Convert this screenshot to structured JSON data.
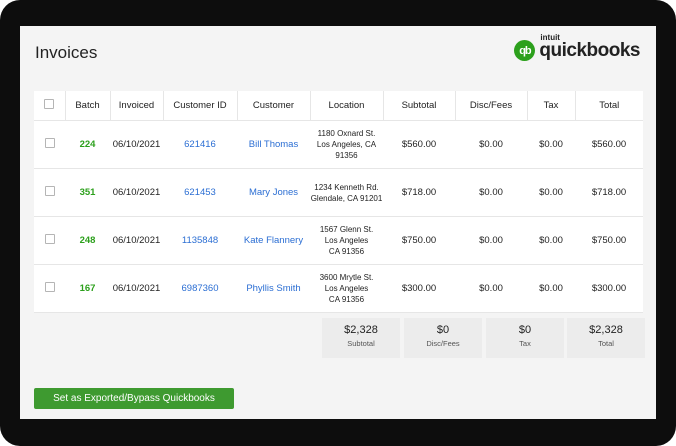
{
  "page": {
    "title": "Invoices"
  },
  "logo": {
    "brand_small": "intuit",
    "brand": "quickbooks",
    "mark": "qb",
    "color": "#2ca01c"
  },
  "table": {
    "headers": [
      "",
      "Batch",
      "Invoiced",
      "Customer ID",
      "Customer",
      "Location",
      "Subtotal",
      "Disc/Fees",
      "Tax",
      "Total"
    ],
    "rows": [
      {
        "batch": "224",
        "invoiced": "06/10/2021",
        "customer_id": "621416",
        "customer": "Bill Thomas",
        "location": [
          "1180 Oxnard St.",
          "Los Angeles, CA",
          "91356"
        ],
        "subtotal": "$560.00",
        "disc": "$0.00",
        "tax": "$0.00",
        "total": "$560.00"
      },
      {
        "batch": "351",
        "invoiced": "06/10/2021",
        "customer_id": "621453",
        "customer": "Mary Jones",
        "location": [
          "1234 Kenneth Rd.",
          "Glendale, CA 91201"
        ],
        "subtotal": "$718.00",
        "disc": "$0.00",
        "tax": "$0.00",
        "total": "$718.00"
      },
      {
        "batch": "248",
        "invoiced": "06/10/2021",
        "customer_id": "1135848",
        "customer": "Kate Flannery",
        "location": [
          "1567 Glenn St.",
          "Los Angeles",
          "CA 91356"
        ],
        "subtotal": "$750.00",
        "disc": "$0.00",
        "tax": "$0.00",
        "total": "$750.00"
      },
      {
        "batch": "167",
        "invoiced": "06/10/2021",
        "customer_id": "6987360",
        "customer": "Phyllis Smith",
        "location": [
          "3600 Mrytle St.",
          "Los Angeles",
          "CA 91356"
        ],
        "subtotal": "$300.00",
        "disc": "$0.00",
        "tax": "$0.00",
        "total": "$300.00"
      }
    ]
  },
  "totals": [
    {
      "value": "$2,328",
      "label": "Subtotal"
    },
    {
      "value": "$0",
      "label": "Disc/Fees"
    },
    {
      "value": "$0",
      "label": "Tax"
    },
    {
      "value": "$2,328",
      "label": "Total"
    }
  ],
  "actions": {
    "export_label": "Set as Exported/Bypass Quickbooks"
  },
  "colors": {
    "accent_green": "#2ca01c",
    "button_green": "#3e9a30",
    "link_blue": "#2b6ed3"
  }
}
